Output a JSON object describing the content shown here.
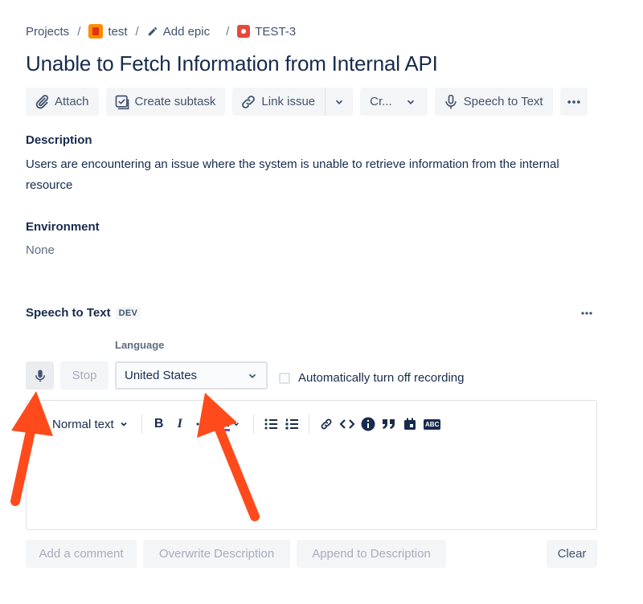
{
  "breadcrumb": {
    "projects": "Projects",
    "project": "test",
    "epic": "Add epic",
    "issue": "TEST-3",
    "separator": "/"
  },
  "issue": {
    "title": "Unable to Fetch Information from Internal API"
  },
  "toolbar": {
    "attach": "Attach",
    "create_subtask": "Create subtask",
    "link_issue": "Link issue",
    "create_short": "Cr...",
    "speech_to_text": "Speech to Text"
  },
  "description": {
    "label": "Description",
    "text": "Users are encountering an issue where the system is unable to retrieve information from the internal resource"
  },
  "environment": {
    "label": "Environment",
    "value": "None"
  },
  "speech_panel": {
    "title": "Speech to Text",
    "badge": "DEV",
    "language_label": "Language",
    "stop_label": "Stop",
    "language_value": "United States",
    "auto_off_label": "Automatically turn off recording",
    "auto_off_checked": false
  },
  "editor": {
    "text_style": "Normal text",
    "bold": "B",
    "italic": "I",
    "color_letter": "A",
    "abc": "ABC"
  },
  "actions": {
    "add_comment": "Add a comment",
    "overwrite": "Overwrite Description",
    "append": "Append to Description",
    "clear": "Clear"
  },
  "colors": {
    "arrow": "#ff4a1c",
    "text_primary": "#172b4d",
    "text_secondary": "#42526e",
    "button_bg": "#f4f5f7"
  },
  "icons": [
    "paperclip-icon",
    "subtask-icon",
    "link-icon",
    "chevron-down-icon",
    "microphone-icon",
    "more-icon",
    "info-icon",
    "quote-icon",
    "calendar-icon"
  ]
}
